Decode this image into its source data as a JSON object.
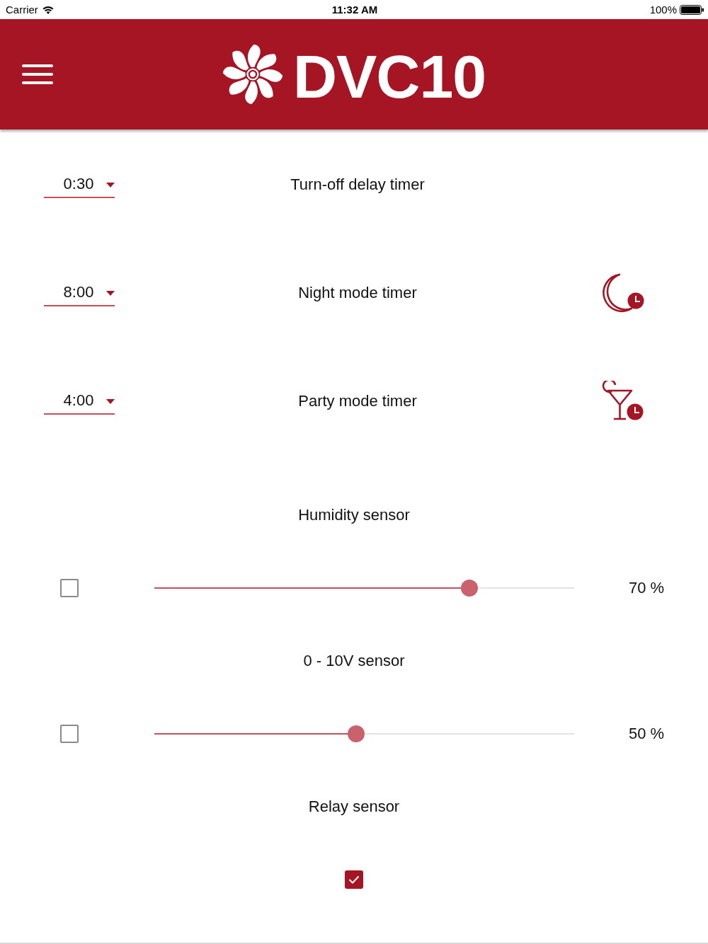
{
  "status_bar": {
    "carrier": "Carrier",
    "time": "11:32 AM",
    "battery": "100%"
  },
  "header": {
    "title": "DVC10"
  },
  "timers": [
    {
      "kind": "plain",
      "value": "0:30",
      "label": "Turn-off delay timer"
    },
    {
      "kind": "night",
      "value": "8:00",
      "label": "Night mode timer"
    },
    {
      "kind": "party",
      "value": "4:00",
      "label": "Party mode timer"
    }
  ],
  "sensors": [
    {
      "kind": "slider",
      "title": "Humidity sensor",
      "checked": false,
      "level": 0.75,
      "reading": "70 %"
    },
    {
      "kind": "slider",
      "title": "0 - 10V sensor",
      "checked": false,
      "level": 0.48,
      "reading": "50 %"
    },
    {
      "kind": "checkbox",
      "title": "Relay sensor",
      "checked": true
    }
  ]
}
